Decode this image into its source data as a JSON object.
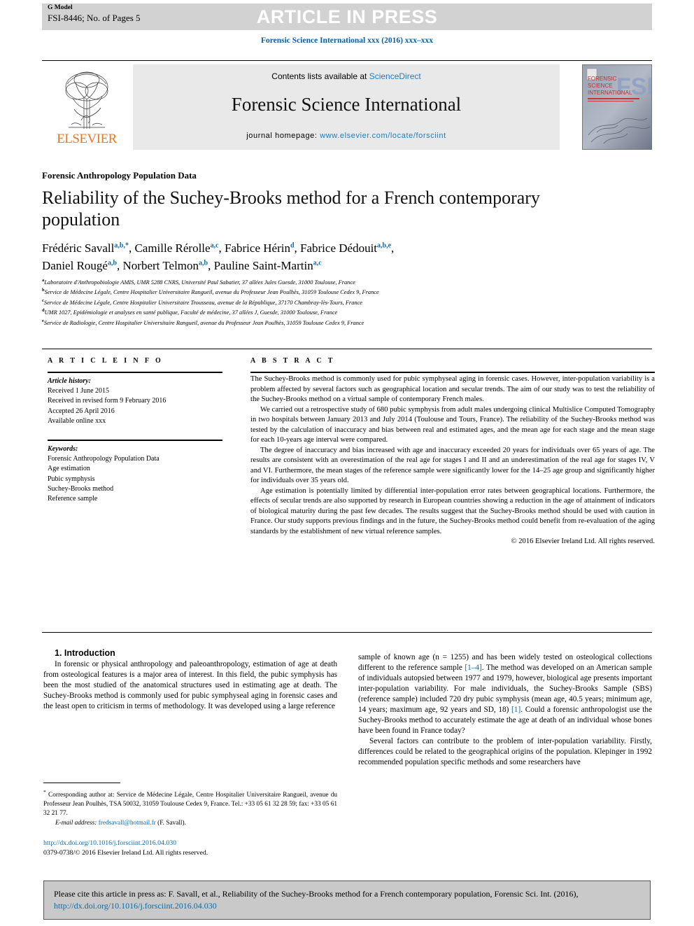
{
  "header": {
    "g_model": "G Model",
    "manuscript_id": "FSI-8446; No. of Pages 5",
    "article_in_press": "ARTICLE IN PRESS",
    "journal_citation": "Forensic Science International xxx (2016) xxx–xxx"
  },
  "masthead": {
    "contents_prefix": "Contents lists available at ",
    "sciencedirect": "ScienceDirect",
    "journal_name": "Forensic Science International",
    "homepage_label": "journal homepage: ",
    "homepage_url": "www.elsevier.com/locate/forsciint",
    "publisher": "ELSEVIER",
    "cover_title_lines": [
      "FORENSIC",
      "SCIENCE",
      "INTERNATIONAL"
    ],
    "cover_logo": "FSI"
  },
  "article": {
    "kicker": "Forensic Anthropology Population Data",
    "title": "Reliability of the Suchey-Brooks method for a French contemporary population",
    "authors_line_1": "Frédéric Savall|a,b,*|, Camille Rérolle|a,c|, Fabrice Hérin|d|, Fabrice Dédouit|a,b,e|,",
    "authors_line_2": "Daniel Rougé|a,b|, Norbert Telmon|a,b|, Pauline Saint-Martin|a,c|",
    "authors": [
      {
        "name": "Frédéric Savall",
        "sup": "a,b,*"
      },
      {
        "name": "Camille Rérolle",
        "sup": "a,c"
      },
      {
        "name": "Fabrice Hérin",
        "sup": "d"
      },
      {
        "name": "Fabrice Dédouit",
        "sup": "a,b,e"
      },
      {
        "name": "Daniel Rougé",
        "sup": "a,b"
      },
      {
        "name": "Norbert Telmon",
        "sup": "a,b"
      },
      {
        "name": "Pauline Saint-Martin",
        "sup": "a,c"
      }
    ],
    "affiliations": [
      {
        "mark": "a",
        "text": "Laboratoire d'Anthropobiologie AMIS, UMR 5288 CNRS, Université Paul Sabatier, 37 allées Jules Guesde, 31000 Toulouse, France"
      },
      {
        "mark": "b",
        "text": "Service de Médecine Légale, Centre Hospitalier Universitaire Rangueil, avenue du Professeur Jean Poulhès, 31059 Toulouse Cedex 9, France"
      },
      {
        "mark": "c",
        "text": "Service de Médecine Légale, Centre Hospitalier Universitaire Trousseau, avenue de la République, 37170 Chambray-lès-Tours, France"
      },
      {
        "mark": "d",
        "text": "UMR 1027, Epidémiologie et analyses en santé publique, Faculté de médecine, 37 allées J, Guesde, 31000 Toulouse, France"
      },
      {
        "mark": "e",
        "text": "Service de Radiologie, Centre Hospitalier Universitaire Rangueil, avenue du Professeur Jean Poulhès, 31059 Toulouse Cedex 9, France"
      }
    ]
  },
  "article_info": {
    "heading": "A R T I C L E  I N F O",
    "history_label": "Article history:",
    "history": [
      "Received 1 June 2015",
      "Received in revised form 9 February 2016",
      "Accepted 26 April 2016",
      "Available online xxx"
    ],
    "keywords_label": "Keywords:",
    "keywords": [
      "Forensic Anthropology Population Data",
      "Age estimation",
      "Pubic symphysis",
      "Suchey-Brooks method",
      "Reference sample"
    ]
  },
  "abstract": {
    "heading": "A B S T R A C T",
    "paragraphs": [
      "The Suchey-Brooks method is commonly used for pubic symphyseal aging in forensic cases. However, inter-population variability is a problem affected by several factors such as geographical location and secular trends. The aim of our study was to test the reliability of the Suchey-Brooks method on a virtual sample of contemporary French males.",
      "We carried out a retrospective study of 680 pubic symphysis from adult males undergoing clinical Multislice Computed Tomography in two hospitals between January 2013 and July 2014 (Toulouse and Tours, France). The reliability of the Suchey-Brooks method was tested by the calculation of inaccuracy and bias between real and estimated ages, and the mean age for each stage and the mean stage for each 10-years age interval were compared.",
      "The degree of inaccuracy and bias increased with age and inaccuracy exceeded 20 years for individuals over 65 years of age. The results are consistent with an overestimation of the real age for stages I and II and an underestimation of the real age for stages IV, V and VI. Furthermore, the mean stages of the reference sample were significantly lower for the 14–25 age group and significantly higher for individuals over 35 years old.",
      "Age estimation is potentially limited by differential inter-population error rates between geographical locations. Furthermore, the effects of secular trends are also supported by research in European countries showing a reduction in the age of attainment of indicators of biological maturity during the past few decades. The results suggest that the Suchey-Brooks method should be used with caution in France. Our study supports previous findings and in the future, the Suchey-Brooks method could benefit from re-evaluation of the aging standards by the establishment of new virtual reference samples."
    ],
    "copyright": "© 2016 Elsevier Ireland Ltd. All rights reserved."
  },
  "body": {
    "section_title": "1. Introduction",
    "left_paragraph": "In forensic or physical anthropology and paleoanthropology, estimation of age at death from osteological features is a major area of interest. In this field, the pubic symphysis has been the most studied of the anatomical structures used in estimating age at death. The Suchey-Brooks method is commonly used for pubic symphyseal aging in forensic cases and the least open to criticism in terms of methodology. It was developed using a large reference",
    "right_paragraph_1_a": "sample of known age (n = 1255) and has been widely tested on osteological collections different to the reference sample ",
    "right_ref_1": "[1–4]",
    "right_paragraph_1_b": ". The method was developed on an American sample of individuals autopsied between 1977 and 1979, however, biological age presents important inter-population variability. For male individuals, the Suchey-Brooks Sample (SBS) (reference sample) included 720 dry pubic symphysis (mean age, 40.5 years; minimum age, 14 years; maximum age, 92 years and SD, 18) ",
    "right_ref_2": "[1]",
    "right_paragraph_1_c": ". Could a forensic anthropologist use the Suchey-Brooks method to accurately estimate the age at death of an individual whose bones have been found in France today?",
    "right_paragraph_2": "Several factors can contribute to the problem of inter-population variability. Firstly, differences could be related to the geographical origins of the population. Klepinger in 1992 recommended population specific methods and some researchers have"
  },
  "footnotes": {
    "corresponding_mark": "*",
    "corresponding_text": " Corresponding author at: Service de Médecine Légale, Centre Hospitalier Universitaire Rangueil, avenue du Professeur Jean Poulhès, TSA 50032, 31059 Toulouse Cedex 9, France. Tel.: +33 05 61 32 28 59; fax: +33 05 61 32 21 77.",
    "email_label": "E-mail address:",
    "email": "fredsavall@hotmail.fr",
    "email_owner": "(F. Savall).",
    "doi": "http://dx.doi.org/10.1016/j.forsciint.2016.04.030",
    "issn_line": "0379-0738/© 2016 Elsevier Ireland Ltd. All rights reserved."
  },
  "cite_box": {
    "text_before": "Please cite this article in press as: F. Savall, et al., Reliability of the Suchey-Brooks method for a French contemporary population, Forensic Sci. Int. (2016), ",
    "link": "http://dx.doi.org/10.1016/j.forsciint.2016.04.030"
  },
  "colors": {
    "link_blue": "#0d6aa8",
    "elsevier_orange": "#E87722",
    "banner_grey": "#d2d2d2",
    "masthead_grey": "#e9e9e9",
    "cite_grey": "#c9c9c9"
  }
}
